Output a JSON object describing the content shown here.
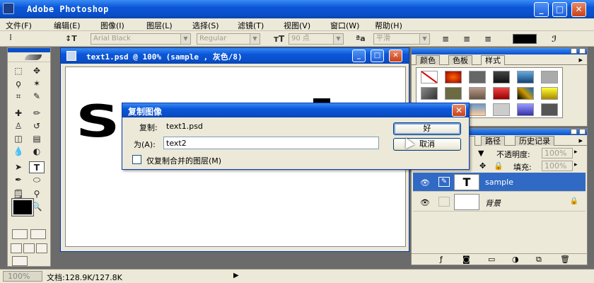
{
  "app": {
    "title": "Adobe Photoshop"
  },
  "menu": [
    "文件(F)",
    "编辑(E)",
    "图像(I)",
    "图层(L)",
    "选择(S)",
    "滤镜(T)",
    "视图(V)",
    "窗口(W)",
    "帮助(H)"
  ],
  "options": {
    "font_family": "Arial Black",
    "font_style": "Regular",
    "font_size": "90 点",
    "aa_label": "ªa",
    "antialias": "平滑"
  },
  "document": {
    "title": "text1.psd @ 100% (sample    , 灰色/8)",
    "sample_text": "S"
  },
  "dialog": {
    "title": "复制图像",
    "source_label": "复制:",
    "source_value": "text1.psd",
    "as_label": "为(A):",
    "as_value": "text2",
    "merged_label": "仅复制合并的图层(M)",
    "ok": "好",
    "cancel": "取消"
  },
  "styles_palette": {
    "tabs": [
      "颜色",
      "色板",
      "样式"
    ]
  },
  "layers_palette": {
    "tabs": [
      "路径",
      "历史记录"
    ],
    "opacity_label": "不透明度:",
    "opacity_value": "100%",
    "fill_label": "填充:",
    "fill_value": "100%",
    "layers": [
      {
        "name": "sample",
        "thumb": "T",
        "selected": true
      },
      {
        "name": "背景",
        "thumb": "",
        "selected": false
      }
    ]
  },
  "status": {
    "zoom": "100%",
    "doc_info": "文档:128.9K/127.8K"
  },
  "colors": {
    "titlebar": "#0a4fc9",
    "face": "#ece9d8",
    "selection": "#316ac5"
  }
}
